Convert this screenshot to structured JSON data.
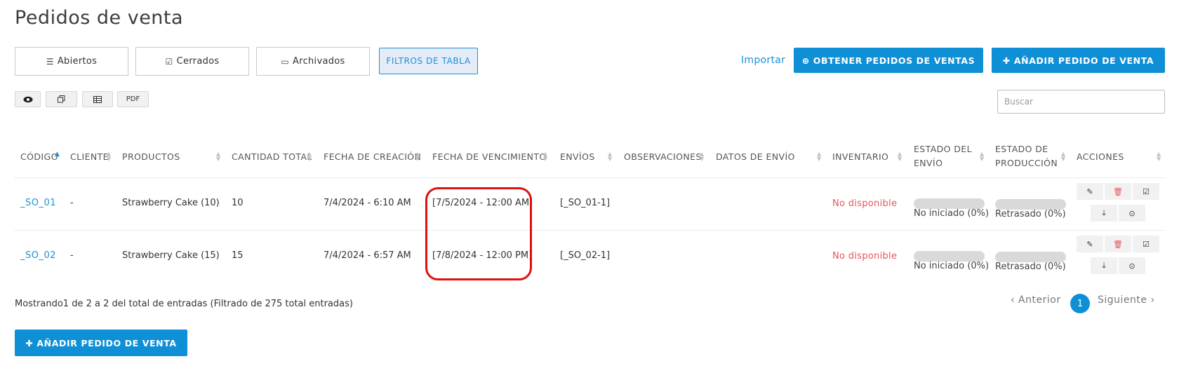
{
  "page": {
    "title": "Pedidos de venta"
  },
  "tabs": [
    {
      "icon": "list-icon",
      "glyph": "☰",
      "label": "Abiertos"
    },
    {
      "icon": "check-square-icon",
      "glyph": "☑",
      "label": "Cerrados"
    },
    {
      "icon": "archive-icon",
      "glyph": "▭",
      "label": "Archivados"
    }
  ],
  "filter_button": "FILTROS DE TABLA",
  "header_actions": {
    "import_label": "Importar",
    "obtain_label": "OBTENER PEDIDOS DE VENTAS",
    "add_label": "AÑADIR PEDIDO DE VENTA"
  },
  "toolbar": {
    "view_icon": "eye-icon",
    "copy_icon": "copy-icon",
    "table_icon": "table-icon",
    "pdf_label": "PDF"
  },
  "search": {
    "placeholder": "Buscar",
    "value": ""
  },
  "columns": {
    "codigo": "CÓDIGO",
    "cliente": "CLIENTE",
    "productos": "PRODUCTOS",
    "cantidad": "CANTIDAD TOTAL",
    "creacion": "FECHA DE CREACIÓN",
    "vencimiento": "FECHA DE VENCIMIENTO",
    "envios": "ENVÍOS",
    "observaciones": "OBSERVACIONES",
    "datos_envio": "DATOS DE ENVÍO",
    "inventario": "INVENTARIO",
    "estado_envio_1": "ESTADO DEL",
    "estado_envio_2": "ENVÍO",
    "estado_prod_1": "ESTADO DE",
    "estado_prod_2": "PRODUCCIÓN",
    "acciones": "ACCIONES"
  },
  "rows": [
    {
      "codigo": "_SO_01",
      "cliente": "-",
      "productos": "Strawberry Cake (10)",
      "cantidad": "10",
      "creacion": "7/4/2024 - 6:10 AM",
      "vencimiento": "[7/5/2024 - 12:00 AM]",
      "envios": "[_SO_01-1]",
      "inventario": "No disponible",
      "estado_envio": "No iniciado (0%)",
      "estado_envio_progress": 0,
      "estado_prod": "Retrasado (0%)",
      "estado_prod_progress": 0
    },
    {
      "codigo": "_SO_02",
      "cliente": "-",
      "productos": "Strawberry Cake (15)",
      "cantidad": "15",
      "creacion": "7/4/2024 - 6:57 AM",
      "vencimiento": "[7/8/2024 - 12:00 PM]",
      "envios": "[_SO_02-1]",
      "inventario": "No disponible",
      "estado_envio": "No iniciado (0%)",
      "estado_envio_progress": 0,
      "estado_prod": "Retrasado (0%)",
      "estado_prod_progress": 0
    }
  ],
  "row_action_icons": [
    "edit-icon",
    "delete-icon",
    "close-order-icon",
    "download-icon",
    "history-icon"
  ],
  "footer": {
    "summary": "Mostrando1 de 2 a 2 del total de entradas (Filtrado de 275 total entradas)",
    "prev": "‹ Anterior",
    "page": "1",
    "next": "Siguiente ›"
  },
  "bottom_add_label": "AÑADIR PEDIDO DE VENTA",
  "colors": {
    "primary": "#0f90d6",
    "link": "#1f8fd6",
    "danger": "#e8555a",
    "highlight": "#e01010"
  }
}
